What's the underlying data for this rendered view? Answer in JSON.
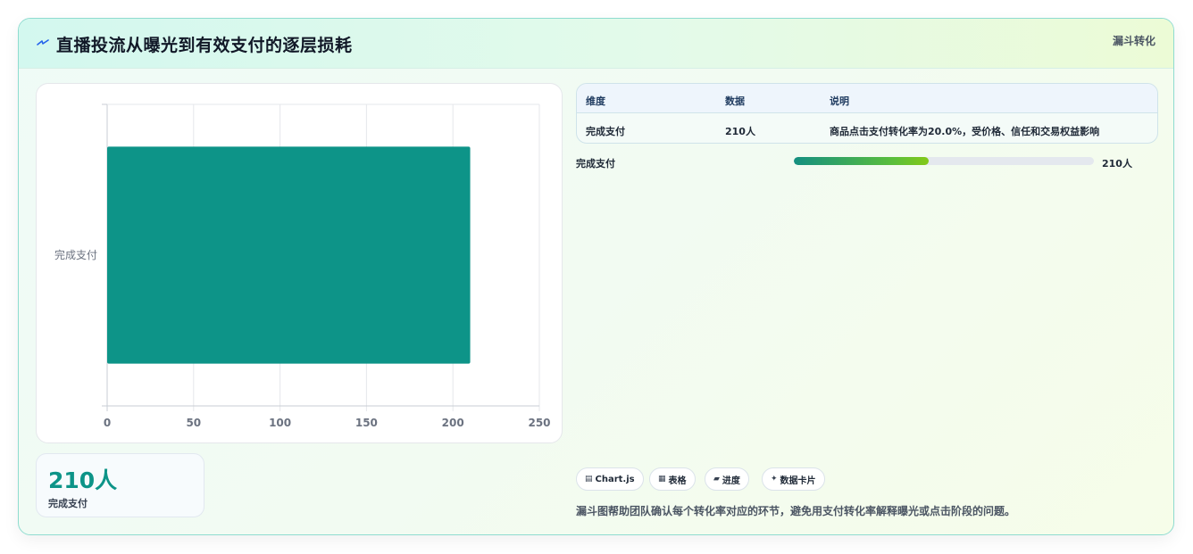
{
  "header": {
    "title": "直播投流从曝光到有效支付的逐层损耗",
    "tag": "漏斗转化"
  },
  "table": {
    "columns": [
      "维度",
      "数据",
      "说明"
    ],
    "rows": [
      {
        "dimension": "完成支付",
        "data": "210人",
        "note": "商品点击支付转化率为20.0%，受价格、信任和交易权益影响"
      }
    ]
  },
  "progress": {
    "label": "完成支付",
    "value_text": "210人",
    "fraction": 0.45
  },
  "kpi": {
    "value": "210人",
    "label": "完成支付"
  },
  "chips": [
    {
      "icon": "chart-icon",
      "glyph": "▤",
      "label": "Chart.js"
    },
    {
      "icon": "table-icon",
      "glyph": "▦",
      "label": "表格"
    },
    {
      "icon": "progress-icon",
      "glyph": "▰",
      "label": "进度"
    },
    {
      "icon": "sparkle-icon",
      "glyph": "✦",
      "label": "数据卡片"
    }
  ],
  "footnote": "漏斗图帮助团队确认每个转化率对应的环节，避免用支付转化率解释曝光或点击阶段的问题。",
  "colors": {
    "bar": "#0d9488",
    "accent": "#0d9488",
    "border": "#8fdcd0"
  },
  "chart_data": {
    "type": "bar",
    "orientation": "horizontal",
    "categories": [
      "完成支付"
    ],
    "values": [
      210
    ],
    "xlim": [
      0,
      250
    ],
    "xticks": [
      0,
      50,
      100,
      150,
      200,
      250
    ],
    "grid": true,
    "legend": "none"
  }
}
